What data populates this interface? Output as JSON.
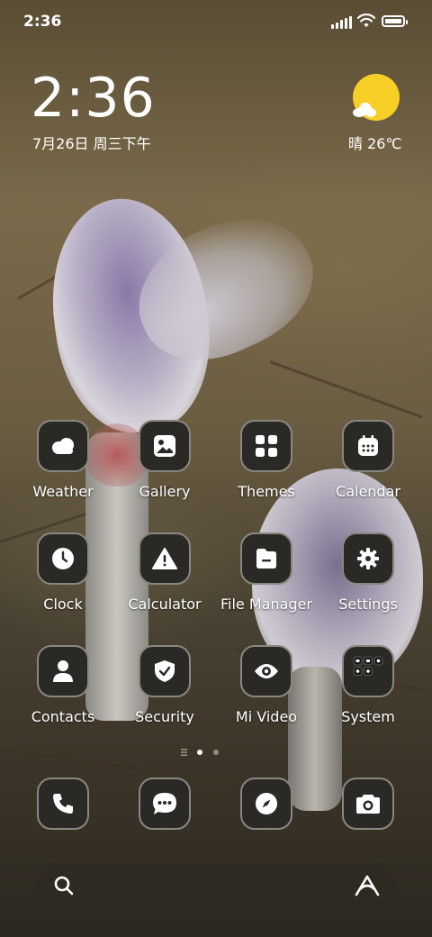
{
  "status": {
    "time": "2:36"
  },
  "lockclock": {
    "time": "2:36",
    "date": "7月26日 周三下午"
  },
  "weather": {
    "text": "晴 26℃",
    "sun_color": "#f7cf26"
  },
  "apps": [
    {
      "label": "Weather",
      "icon": "weather-icon"
    },
    {
      "label": "Gallery",
      "icon": "gallery-icon"
    },
    {
      "label": "Themes",
      "icon": "themes-icon"
    },
    {
      "label": "Calendar",
      "icon": "calendar-icon"
    },
    {
      "label": "Clock",
      "icon": "clock-icon"
    },
    {
      "label": "Calculator",
      "icon": "calculator-icon"
    },
    {
      "label": "File Manager",
      "icon": "file-manager-icon"
    },
    {
      "label": "Settings",
      "icon": "settings-icon"
    },
    {
      "label": "Contacts",
      "icon": "contacts-icon"
    },
    {
      "label": "Security",
      "icon": "security-icon"
    },
    {
      "label": "Mi Video",
      "icon": "mi-video-icon"
    },
    {
      "label": "System",
      "icon": "system-folder-icon"
    }
  ],
  "dock": [
    {
      "icon": "phone-icon"
    },
    {
      "icon": "messages-icon"
    },
    {
      "icon": "browser-icon"
    },
    {
      "icon": "camera-icon"
    }
  ],
  "search": {
    "left_icon": "search-icon",
    "right_icon": "assistant-icon"
  },
  "colors": {
    "icon_bg": "#2b2926",
    "icon_border": "#8a8780"
  }
}
